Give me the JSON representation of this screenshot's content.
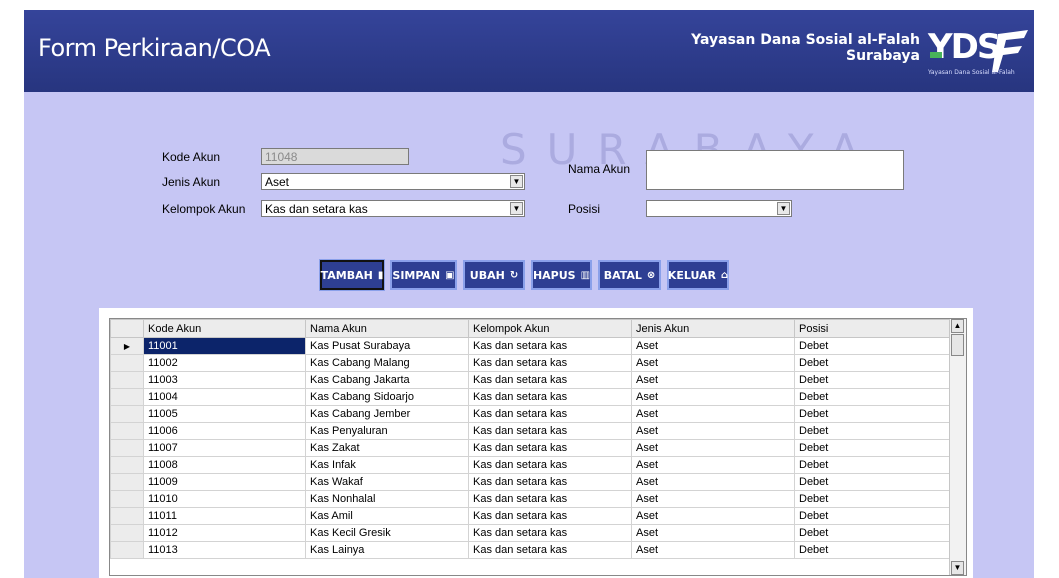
{
  "header": {
    "title": "Form Perkiraan/COA",
    "org_line1": "Yayasan Dana Sosial al-Falah",
    "org_line2": "Surabaya",
    "logo_text": "YDSF",
    "logo_caption": "Yayasan Dana Sosial al-Falah"
  },
  "watermark": "SURABAYA",
  "form": {
    "kode_akun_label": "Kode Akun",
    "kode_akun_value": "11048",
    "jenis_akun_label": "Jenis Akun",
    "jenis_akun_value": "Aset",
    "kelompok_akun_label": "Kelompok Akun",
    "kelompok_akun_value": "Kas dan setara kas",
    "nama_akun_label": "Nama Akun",
    "nama_akun_value": "",
    "posisi_label": "Posisi",
    "posisi_value": ""
  },
  "buttons": {
    "tambah": "TAMBAH",
    "simpan": "SIMPAN",
    "ubah": "UBAH",
    "hapus": "HAPUS",
    "batal": "BATAL",
    "keluar": "KELUAR"
  },
  "grid": {
    "columns": [
      "Kode Akun",
      "Nama Akun",
      "Kelompok Akun",
      "Jenis Akun",
      "Posisi"
    ],
    "rows": [
      [
        "11001",
        "Kas Pusat Surabaya",
        "Kas dan setara kas",
        "Aset",
        "Debet"
      ],
      [
        "11002",
        "Kas Cabang Malang",
        "Kas dan setara kas",
        "Aset",
        "Debet"
      ],
      [
        "11003",
        "Kas Cabang Jakarta",
        "Kas dan setara kas",
        "Aset",
        "Debet"
      ],
      [
        "11004",
        "Kas Cabang Sidoarjo",
        "Kas dan setara kas",
        "Aset",
        "Debet"
      ],
      [
        "11005",
        "Kas Cabang Jember",
        "Kas dan setara kas",
        "Aset",
        "Debet"
      ],
      [
        "11006",
        "Kas Penyaluran",
        "Kas dan setara kas",
        "Aset",
        "Debet"
      ],
      [
        "11007",
        "Kas Zakat",
        "Kas dan setara kas",
        "Aset",
        "Debet"
      ],
      [
        "11008",
        "Kas Infak",
        "Kas dan setara kas",
        "Aset",
        "Debet"
      ],
      [
        "11009",
        "Kas Wakaf",
        "Kas dan setara kas",
        "Aset",
        "Debet"
      ],
      [
        "11010",
        "Kas Nonhalal",
        "Kas dan setara kas",
        "Aset",
        "Debet"
      ],
      [
        "11011",
        "Kas Amil",
        "Kas dan setara kas",
        "Aset",
        "Debet"
      ],
      [
        "11012",
        "Kas Kecil Gresik",
        "Kas dan setara kas",
        "Aset",
        "Debet"
      ],
      [
        "11013",
        "Kas Lainya",
        "Kas dan setara kas",
        "Aset",
        "Debet"
      ]
    ],
    "selected_row": 0
  },
  "colors": {
    "header_bg": "#2f3e8e",
    "form_bg": "#c6c6f4",
    "button_bg": "#2e3f93",
    "selection": "#0c246a"
  }
}
